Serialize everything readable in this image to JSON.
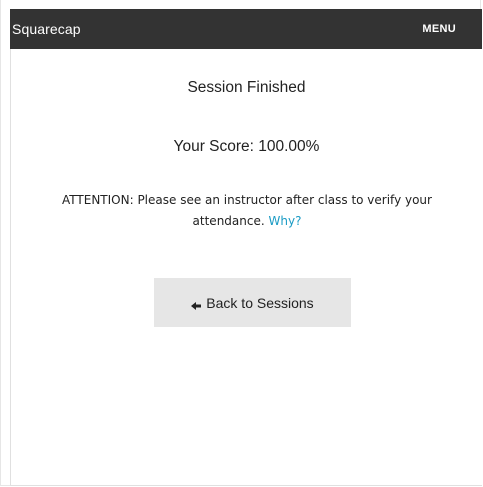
{
  "app": {
    "brand": "Squarecap",
    "menu_label": "MENU"
  },
  "session": {
    "title": "Session Finished",
    "score_text": "Your Score: 100.00%",
    "attention_text": "ATTENTION: Please see an instructor after class to verify your attendance.",
    "why_link": "Why?",
    "back_button_label": "Back to Sessions"
  },
  "icons": {
    "back": "arrow-left-icon"
  },
  "colors": {
    "navbar": "#333333",
    "link": "#1a9bc4",
    "button": "#e6e6e6"
  }
}
